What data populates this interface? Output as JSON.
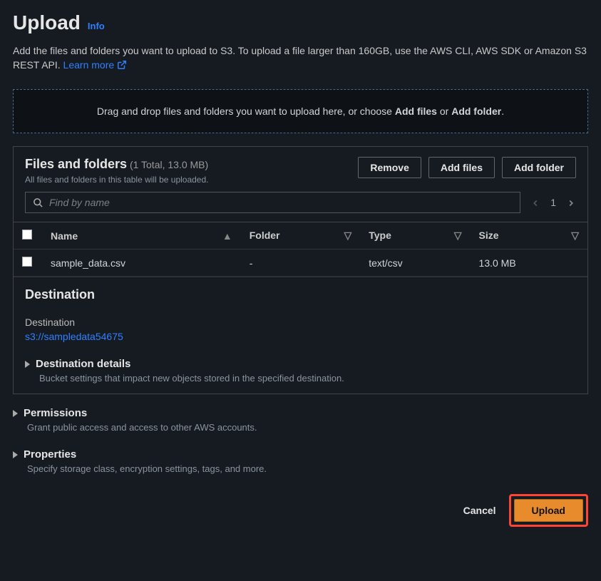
{
  "header": {
    "title": "Upload",
    "info": "Info"
  },
  "description": {
    "text": "Add the files and folders you want to upload to S3. To upload a file larger than 160GB, use the AWS CLI, AWS SDK or Amazon S3 REST API. ",
    "learn_more": "Learn more"
  },
  "dropzone": {
    "prefix": "Drag and drop files and folders you want to upload here, or choose ",
    "add_files": "Add files",
    "or": " or ",
    "add_folder": "Add folder",
    "suffix": "."
  },
  "files_panel": {
    "title": "Files and folders",
    "summary": "(1 Total, 13.0 MB)",
    "note": "All files and folders in this table will be uploaded.",
    "buttons": {
      "remove": "Remove",
      "add_files": "Add files",
      "add_folder": "Add folder"
    },
    "search_placeholder": "Find by name",
    "page": "1",
    "columns": {
      "name": "Name",
      "folder": "Folder",
      "type": "Type",
      "size": "Size"
    },
    "rows": [
      {
        "name": "sample_data.csv",
        "folder": "-",
        "type": "text/csv",
        "size": "13.0 MB"
      }
    ]
  },
  "destination": {
    "title": "Destination",
    "label": "Destination",
    "value": "s3://sampledata54675",
    "details_title": "Destination details",
    "details_desc": "Bucket settings that impact new objects stored in the specified destination."
  },
  "permissions": {
    "title": "Permissions",
    "desc": "Grant public access and access to other AWS accounts."
  },
  "properties": {
    "title": "Properties",
    "desc": "Specify storage class, encryption settings, tags, and more."
  },
  "footer": {
    "cancel": "Cancel",
    "upload": "Upload"
  }
}
